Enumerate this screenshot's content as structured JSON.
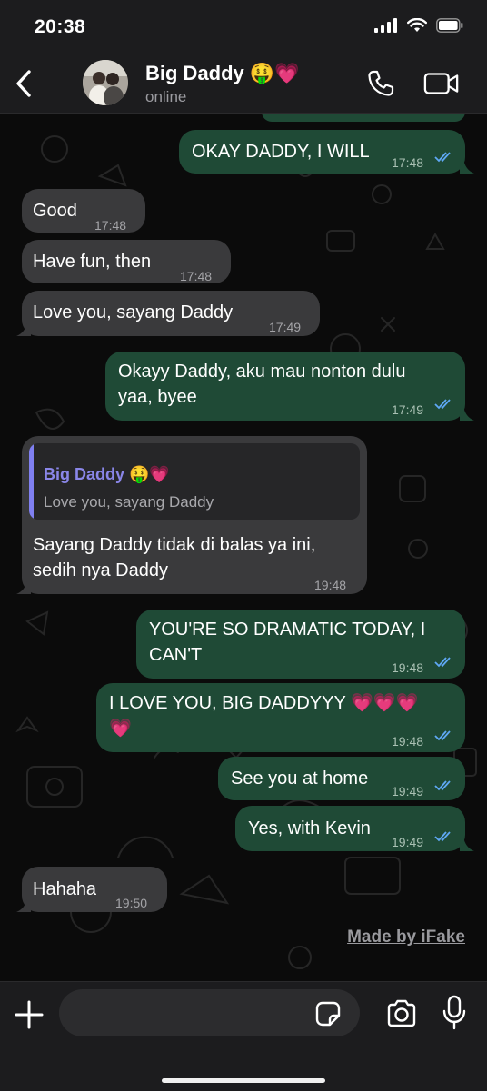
{
  "status_bar": {
    "time": "20:38"
  },
  "header": {
    "contact_name": "Big Daddy 🤑💗",
    "contact_status": "online"
  },
  "messages": [
    {
      "dir": "out",
      "text": "OKAY DADDY, I WILL",
      "time": "17:48",
      "read": true
    },
    {
      "dir": "in",
      "text": "Good",
      "time": "17:48"
    },
    {
      "dir": "in",
      "text": "Have fun, then",
      "time": "17:48"
    },
    {
      "dir": "in",
      "text": "Love you, sayang Daddy",
      "time": "17:49"
    },
    {
      "dir": "out",
      "text_lines": [
        "Okayy Daddy, aku mau nonton dulu",
        "yaa, byee"
      ],
      "time": "17:49",
      "read": true
    },
    {
      "dir": "in",
      "reply_to": {
        "name": "Big Daddy 🤑💗",
        "text": "Love you, sayang Daddy"
      },
      "text_lines": [
        "Sayang Daddy tidak di balas ya ini,",
        "sedih nya Daddy"
      ],
      "time": "19:48"
    },
    {
      "dir": "out",
      "text_lines": [
        "YOU'RE SO DRAMATIC TODAY, I",
        "CAN'T"
      ],
      "time": "19:48",
      "read": true
    },
    {
      "dir": "out",
      "text_lines": [
        "I LOVE YOU, BIG DADDYYY 💗💗💗",
        "💗"
      ],
      "time": "19:48",
      "read": true
    },
    {
      "dir": "out",
      "text": "See you at home",
      "time": "19:49",
      "read": true
    },
    {
      "dir": "out",
      "text": "Yes, with Kevin",
      "time": "19:49",
      "read": true
    },
    {
      "dir": "in",
      "text": "Hahaha",
      "time": "19:50"
    }
  ],
  "watermark": "Made by iFake",
  "composer": {
    "placeholder": "",
    "value": ""
  },
  "icons": {
    "back": "chevron-left-icon",
    "call": "phone-icon",
    "video": "video-camera-icon",
    "add": "plus-icon",
    "sticker": "sticker-icon",
    "camera": "camera-icon",
    "mic": "microphone-icon"
  },
  "colors": {
    "incoming_bubble": "#3a3a3c",
    "outgoing_bubble": "#1f4a36",
    "read_ticks": "#5fa8f5",
    "quote_accent": "#7f7ff0"
  }
}
